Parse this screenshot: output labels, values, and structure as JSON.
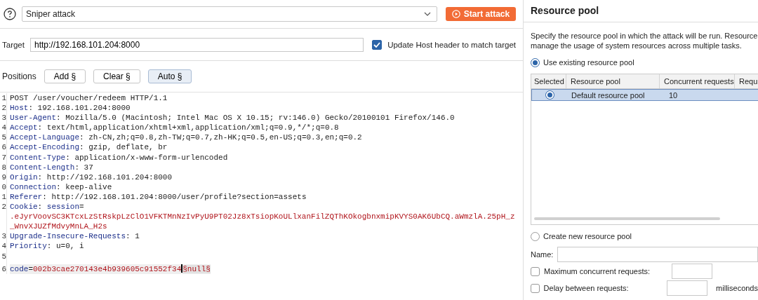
{
  "attack_type": {
    "value": "Sniper attack"
  },
  "start_button": {
    "label": "Start attack"
  },
  "target": {
    "label": "Target",
    "value": "http://192.168.101.204:8000",
    "update_host": {
      "label": "Update Host header to match target",
      "checked": true
    }
  },
  "positions": {
    "label": "Positions",
    "buttons": [
      {
        "label": "Add §",
        "pressed": false
      },
      {
        "label": "Clear §",
        "pressed": false
      },
      {
        "label": "Auto §",
        "pressed": true
      }
    ]
  },
  "editor": {
    "lines": [
      {
        "num": "1",
        "current": false,
        "tokens": [
          {
            "kind": "plain",
            "text": "POST /user/voucher/redeem HTTP/1.1"
          }
        ]
      },
      {
        "num": "2",
        "current": false,
        "tokens": [
          {
            "kind": "key",
            "text": "Host"
          },
          {
            "kind": "plain",
            "text": ": 192.168.101.204:8000"
          }
        ]
      },
      {
        "num": "3",
        "current": false,
        "tokens": [
          {
            "kind": "key",
            "text": "User-Agent"
          },
          {
            "kind": "plain",
            "text": ": Mozilla/5.0 (Macintosh; Intel Mac OS X 10.15; rv:146.0) Gecko/20100101 Firefox/146.0"
          }
        ]
      },
      {
        "num": "4",
        "current": false,
        "tokens": [
          {
            "kind": "key",
            "text": "Accept"
          },
          {
            "kind": "plain",
            "text": ": text/html,application/xhtml+xml,application/xml;q=0.9,*/*;q=0.8"
          }
        ]
      },
      {
        "num": "5",
        "current": false,
        "tokens": [
          {
            "kind": "key",
            "text": "Accept-Language"
          },
          {
            "kind": "plain",
            "text": ": zh-CN,zh;q=0.8,zh-TW;q=0.7,zh-HK;q=0.5,en-US;q=0.3,en;q=0.2"
          }
        ]
      },
      {
        "num": "6",
        "current": false,
        "tokens": [
          {
            "kind": "key",
            "text": "Accept-Encoding"
          },
          {
            "kind": "plain",
            "text": ": gzip, deflate, br"
          }
        ]
      },
      {
        "num": "7",
        "current": false,
        "tokens": [
          {
            "kind": "key",
            "text": "Content-Type"
          },
          {
            "kind": "plain",
            "text": ": application/x-www-form-urlencoded"
          }
        ]
      },
      {
        "num": "8",
        "current": false,
        "tokens": [
          {
            "kind": "key",
            "text": "Content-Length"
          },
          {
            "kind": "plain",
            "text": ": 37"
          }
        ]
      },
      {
        "num": "9",
        "current": false,
        "tokens": [
          {
            "kind": "key",
            "text": "Origin"
          },
          {
            "kind": "plain",
            "text": ": http://192.168.101.204:8000"
          }
        ]
      },
      {
        "num": "0",
        "current": false,
        "tokens": [
          {
            "kind": "key",
            "text": "Connection"
          },
          {
            "kind": "plain",
            "text": ": keep-alive"
          }
        ]
      },
      {
        "num": "1",
        "current": false,
        "tokens": [
          {
            "kind": "key",
            "text": "Referer"
          },
          {
            "kind": "plain",
            "text": ": http://192.168.101.204:8000/user/profile?section=assets"
          }
        ]
      },
      {
        "num": "2",
        "current": false,
        "tokens": [
          {
            "kind": "key",
            "text": "Cookie"
          },
          {
            "kind": "plain",
            "text": ": "
          },
          {
            "kind": "key",
            "text": "session"
          },
          {
            "kind": "plain",
            "text": "="
          },
          {
            "kind": "wrapped",
            "text": ".eJyrVoovSC3KTcxLzStRskpLzClO1VFKTMnNzIvPyU9PT02Jz8xTsiopKoULlxanFilZQThKOkogbnxmipKVYS0AK6UbCQ.aWmzlA.25pH_z"
          },
          {
            "kind": "wrapped",
            "text": "_WnvXJUZfMdvyMnLA_H2s"
          }
        ]
      },
      {
        "num": "3",
        "current": false,
        "tokens": [
          {
            "kind": "key",
            "text": "Upgrade-Insecure-Requests"
          },
          {
            "kind": "plain",
            "text": ": 1"
          }
        ]
      },
      {
        "num": "4",
        "current": false,
        "tokens": [
          {
            "kind": "key",
            "text": "Priority"
          },
          {
            "kind": "plain",
            "text": ": u=0, i"
          }
        ]
      },
      {
        "num": "5",
        "current": false
      },
      {
        "num": "6",
        "current": true,
        "tokens": [
          {
            "kind": "key",
            "text": "code"
          },
          {
            "kind": "plain",
            "text": "="
          },
          {
            "kind": "value",
            "text": "002b3cae270143e4b939605c91552f34"
          },
          {
            "kind": "cursor"
          },
          {
            "kind": "payload",
            "text": "§null§"
          }
        ]
      }
    ]
  },
  "resource_pool": {
    "title": "Resource pool",
    "description": [
      "Specify the resource pool in which the attack will be run. Resource",
      "manage the usage of system resources across multiple tasks."
    ],
    "use_existing": {
      "label": "Use existing resource pool",
      "selected": true
    },
    "table": {
      "columns": [
        "Selected",
        "Resource pool",
        "Concurrent requests",
        "Requ"
      ],
      "rows": [
        {
          "selected": true,
          "name": "Default resource pool",
          "concurrent": "10"
        }
      ]
    },
    "create_new": {
      "label": "Create new resource pool",
      "selected": false
    },
    "name_label": "Name:",
    "max_concurrent": {
      "label": "Maximum concurrent requests:",
      "checked": false
    },
    "delay": {
      "label": "Delay between requests:",
      "checked": false,
      "unit": "milliseconds"
    }
  }
}
